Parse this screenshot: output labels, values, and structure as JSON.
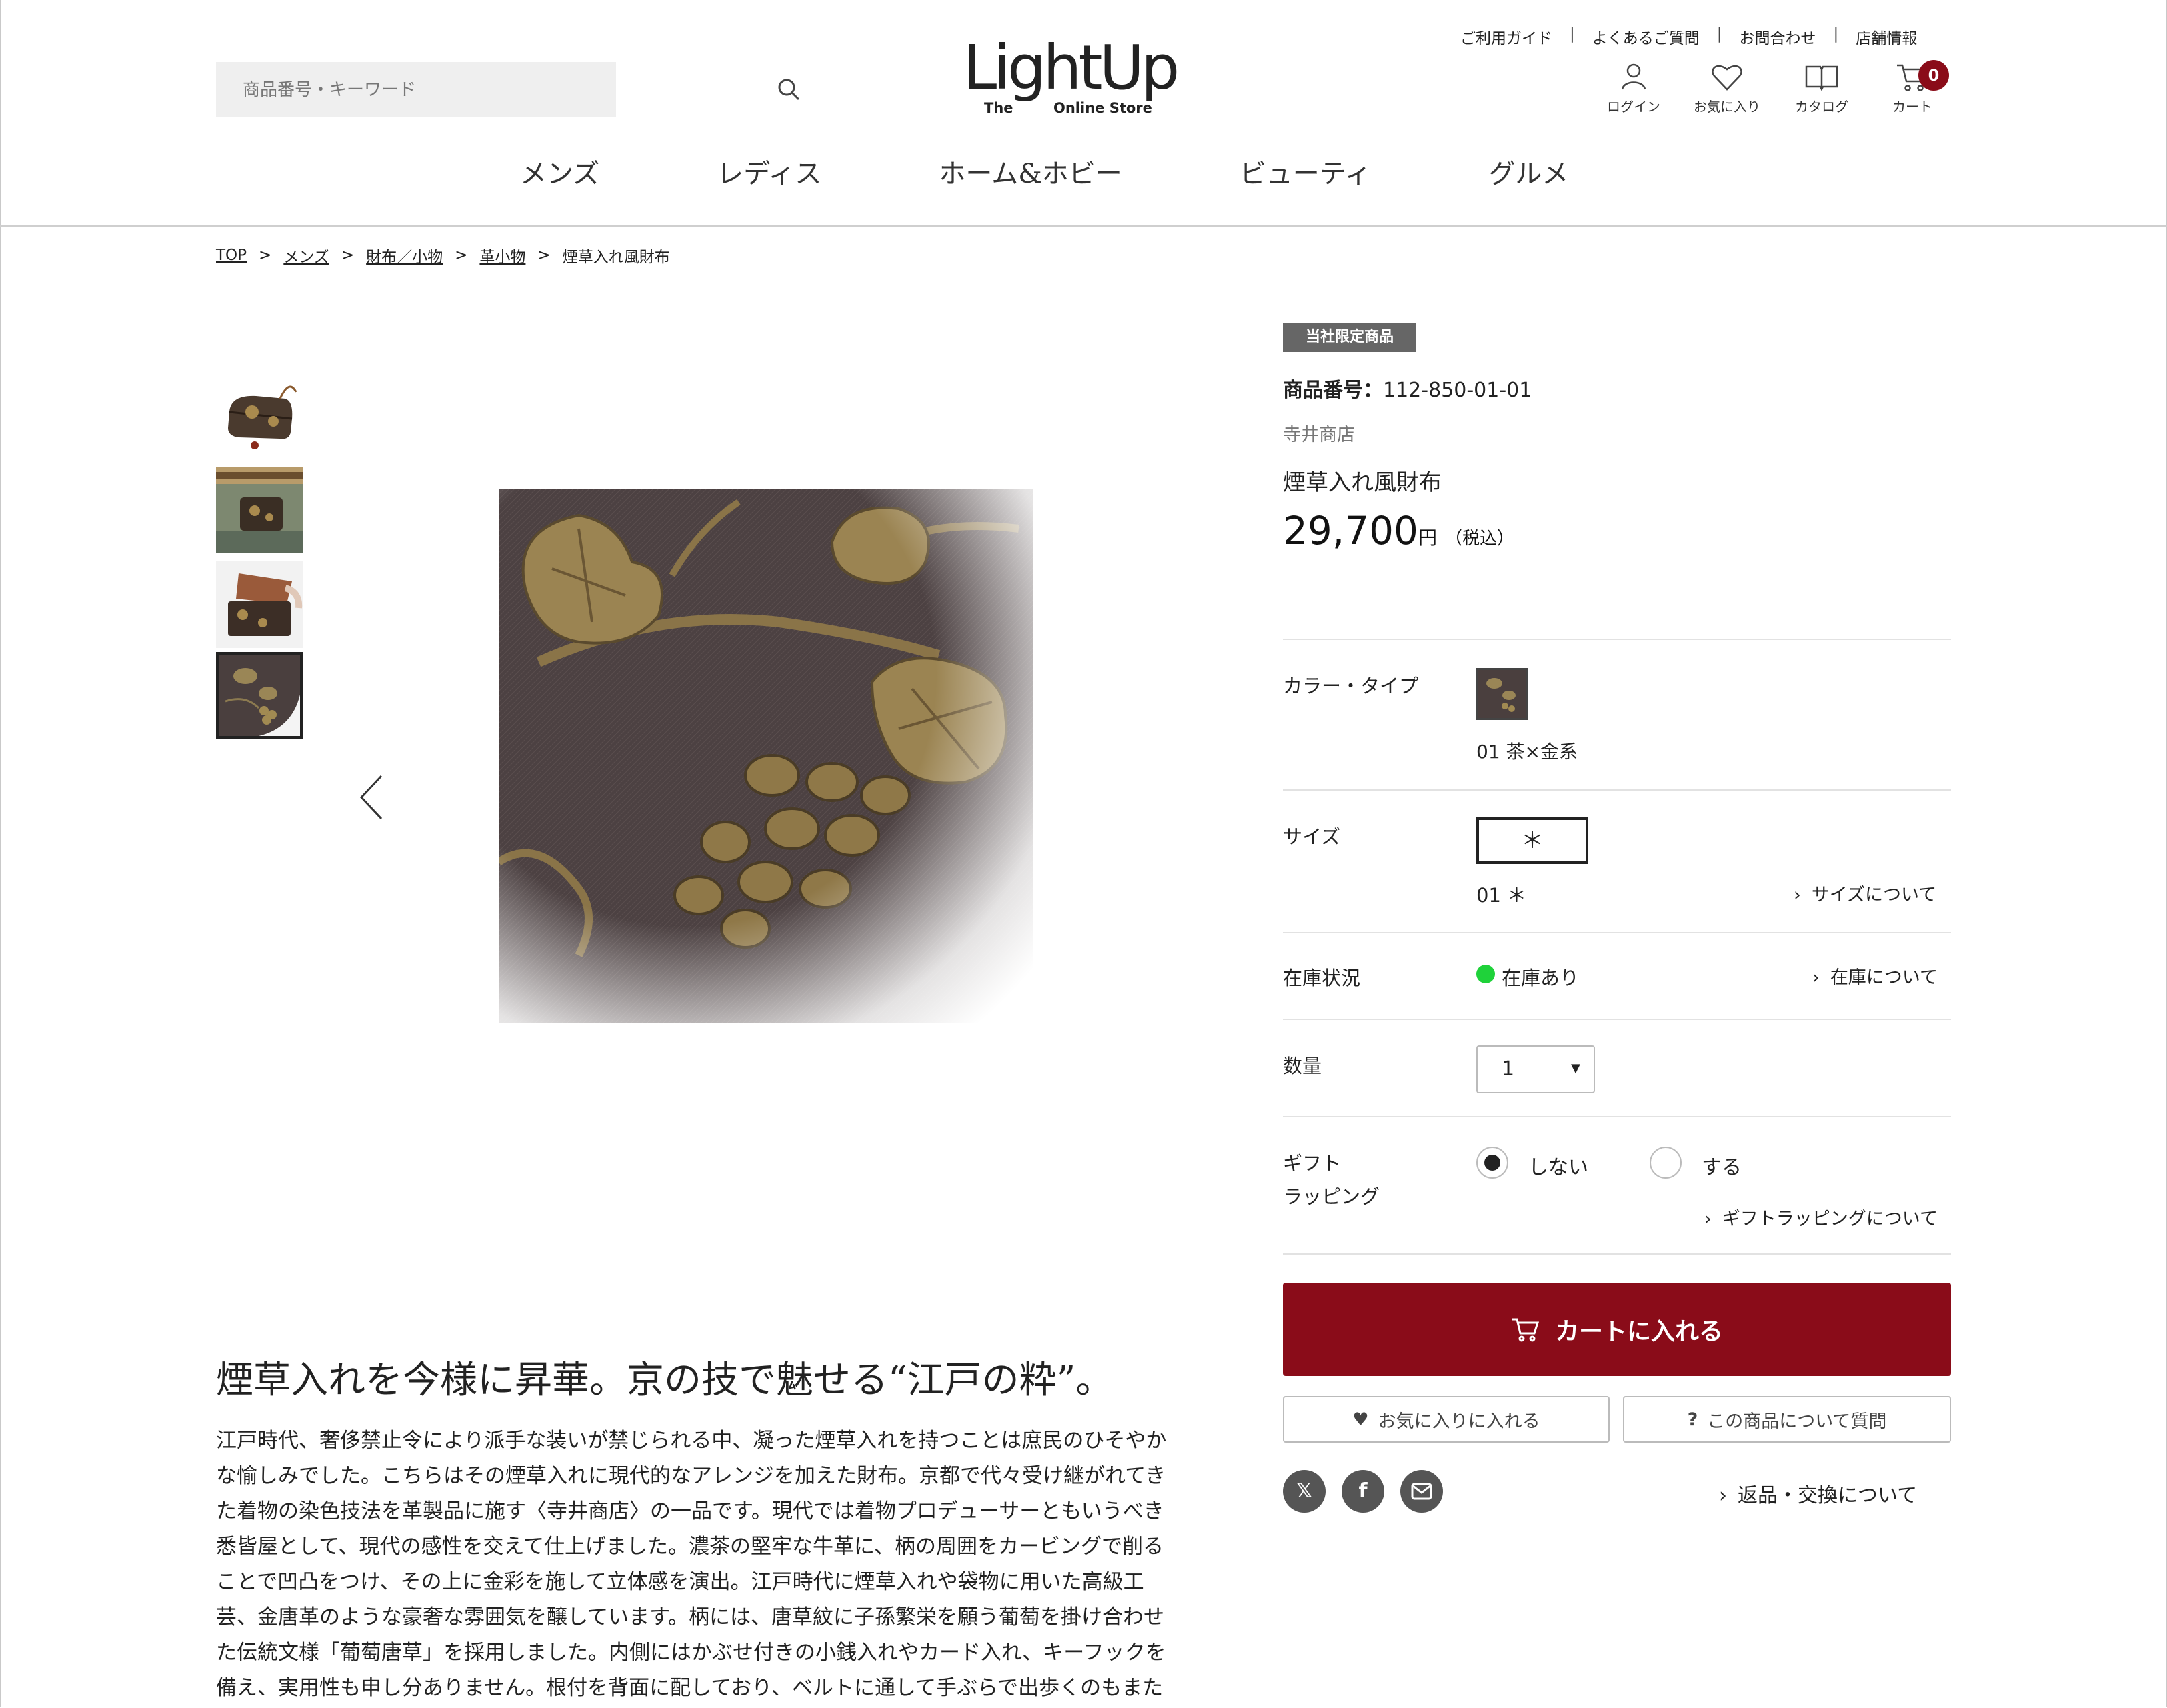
{
  "header": {
    "search_placeholder": "商品番号・キーワード",
    "logo_main": "LightUp",
    "logo_the": "The",
    "logo_store": "Online Store",
    "util_links": [
      "ご利用ガイド",
      "よくあるご質問",
      "お問合わせ",
      "店舗情報"
    ],
    "util_sep": "|",
    "icons": {
      "login": "ログイン",
      "favorites": "お気に入り",
      "catalog": "カタログ",
      "cart": "カート"
    },
    "cart_count": "0",
    "nav": [
      "メンズ",
      "レディス",
      "ホーム&ホビー",
      "ビューティ",
      "グルメ"
    ]
  },
  "breadcrumb": {
    "items": [
      "TOP",
      "メンズ",
      "財布／小物",
      "革小物"
    ],
    "current": "煙草入れ風財布",
    "sep": ">"
  },
  "product": {
    "badge": "当社限定商品",
    "code_label": "商品番号：",
    "code": "112-850-01-01",
    "brand": "寺井商店",
    "name": "煙草入れ風財布",
    "price": "29,700",
    "price_unit": "円",
    "price_tax": "（税込）",
    "color_label": "カラー・タイプ",
    "color_name": "01 茶×金系",
    "size_label": "サイズ",
    "size_option": "＊",
    "size_name": "01 ＊",
    "size_link": "サイズについて",
    "stock_label": "在庫状況",
    "stock_value": "在庫あり",
    "stock_link": "在庫について",
    "qty_label": "数量",
    "qty_value": "1",
    "gift_label_1": "ギフト",
    "gift_label_2": "ラッピング",
    "gift_no": "しない",
    "gift_yes": "する",
    "gift_link": "ギフトラッピングについて",
    "cart_button": "カートに入れる",
    "favorite_button": "お気に入りに入れる",
    "question_button": "この商品について質問",
    "question_mark": "?",
    "returns_link": "返品・交換について",
    "chevron": "›"
  },
  "description": {
    "heading": "煙草入れを今様に昇華。京の技で魅せる“江戸の粋”。",
    "lines": [
      "江戸時代、奢侈禁止令により派手な装いが禁じられる中、凝った煙草入れを持つことは庶民のひそやか",
      "な愉しみでした。こちらはその煙草入れに現代的なアレンジを加えた財布。京都で代々受け継がれてき",
      "た着物の染色技法を革製品に施す〈寺井商店〉の一品です。現代では着物プロデューサーともいうべき",
      "悉皆屋として、現代の感性を交えて仕上げました。濃茶の堅牢な牛革に、柄の周囲をカービングで削る",
      "ことで凹凸をつけ、その上に金彩を施して立体感を演出。江戸時代に煙草入れや袋物に用いた高級工",
      "芸、金唐革のような豪奢な雰囲気を醸しています。柄には、唐草紋に子孫繁栄を願う葡萄を掛け合わせ",
      "た伝統文様「葡萄唐草」を採用しました。内側にはかぶせ付きの小銭入れやカード入れ、キーフックを",
      "備え、実用性も申し分ありません。根付を背面に配しており、ベルトに通して手ぶらで出歩くのもまた"
    ]
  },
  "colors": {
    "accent": "#8a0c19",
    "stock_ok": "#1fd23a",
    "badge_bg": "#666666"
  }
}
